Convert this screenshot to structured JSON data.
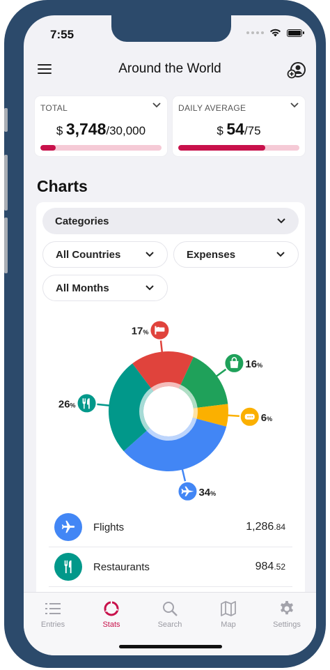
{
  "status": {
    "time": "7:55"
  },
  "header": {
    "title": "Around the World"
  },
  "cards": {
    "total": {
      "label": "TOTAL",
      "currency": "$",
      "amount": "3,748",
      "limit": "/30,000",
      "progress": 0.125
    },
    "daily": {
      "label": "DAILY AVERAGE",
      "currency": "$",
      "amount": "54",
      "limit": "/75",
      "progress": 0.72
    }
  },
  "section_title": "Charts",
  "filters": {
    "grouping": "Categories",
    "countries": "All Countries",
    "type": "Expenses",
    "months": "All Months"
  },
  "colors": {
    "accent": "#c8114b",
    "lodging": "#e0433c",
    "shopping": "#1fa15a",
    "other": "#fbb000",
    "flights": "#4286f5",
    "restaurants": "#01988a"
  },
  "chart_data": {
    "type": "pie",
    "donut": true,
    "slices": [
      {
        "category": "Lodging",
        "icon": "bed-icon",
        "percent": 17,
        "label": "17",
        "unit": "%",
        "color": "#e0433c"
      },
      {
        "category": "Shopping",
        "icon": "shopping-bag-icon",
        "percent": 16,
        "label": "16",
        "unit": "%",
        "color": "#1fa15a"
      },
      {
        "category": "Other",
        "icon": "tag-icon",
        "percent": 6,
        "label": "6",
        "unit": "%",
        "color": "#fbb000"
      },
      {
        "category": "Flights",
        "icon": "airplane-icon",
        "percent": 34,
        "label": "34",
        "unit": "%",
        "color": "#4286f5"
      },
      {
        "category": "Restaurants",
        "icon": "fork-knife-icon",
        "percent": 26,
        "label": "26",
        "unit": "%",
        "color": "#01988a"
      }
    ]
  },
  "legend": [
    {
      "name": "Flights",
      "icon": "airplane-icon",
      "whole": "1,286",
      "cents": ".84"
    },
    {
      "name": "Restaurants",
      "icon": "fork-knife-icon",
      "whole": "984",
      "cents": ".52"
    }
  ],
  "tabs": [
    {
      "label": "Entries",
      "icon": "list-icon"
    },
    {
      "label": "Stats",
      "icon": "donut-icon"
    },
    {
      "label": "Search",
      "icon": "search-icon"
    },
    {
      "label": "Map",
      "icon": "map-icon"
    },
    {
      "label": "Settings",
      "icon": "gear-icon"
    }
  ]
}
